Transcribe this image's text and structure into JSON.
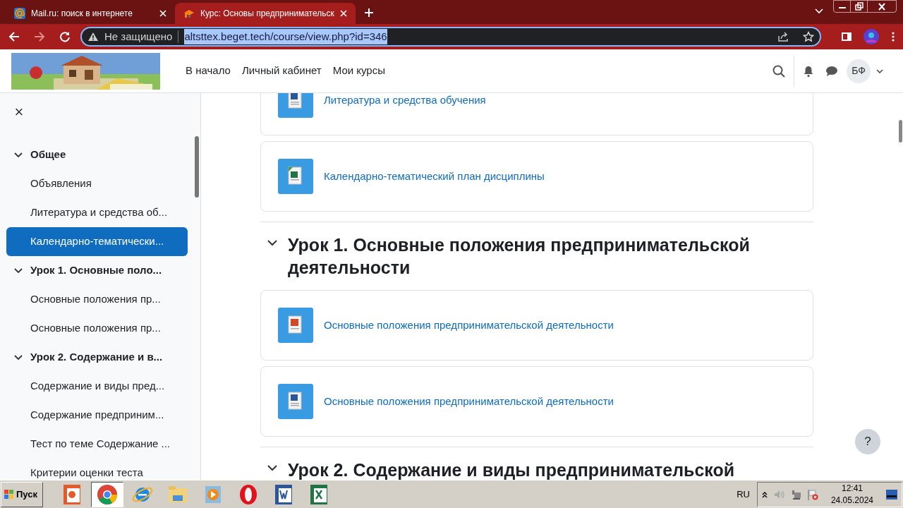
{
  "browser": {
    "tabs": [
      {
        "title": "Mail.ru: поиск в интернете",
        "kind": "mail",
        "selected": false
      },
      {
        "title": "Курс: Основы предпринимательск",
        "kind": "moodle",
        "selected": true
      }
    ],
    "security": "Не защищено",
    "url": "altsttex.beget.tech/course/view.php?id=346"
  },
  "header": {
    "nav": [
      "В начало",
      "Личный кабинет",
      "Мои курсы"
    ],
    "avatar": "БФ"
  },
  "sidebar": {
    "close": "×",
    "items": [
      {
        "kind": "section",
        "label": "Общее",
        "expanded": true,
        "selected": false
      },
      {
        "kind": "item",
        "label": "Объявления",
        "selected": false
      },
      {
        "kind": "item",
        "label": "Литература и средства об...",
        "selected": false
      },
      {
        "kind": "item",
        "label": "Календарно-тематически...",
        "selected": true
      },
      {
        "kind": "section",
        "label": "Урок 1. Основные поло...",
        "expanded": true,
        "selected": false
      },
      {
        "kind": "item",
        "label": "Основные положения пр...",
        "selected": false
      },
      {
        "kind": "item",
        "label": "Основные положения пр...",
        "selected": false
      },
      {
        "kind": "section",
        "label": "Урок 2. Содержание и в...",
        "expanded": true,
        "selected": false
      },
      {
        "kind": "item",
        "label": "Содержание и виды пред...",
        "selected": false
      },
      {
        "kind": "item",
        "label": "Содержание предприним...",
        "selected": false
      },
      {
        "kind": "item",
        "label": "Тест по теме Содержание ...",
        "selected": false
      },
      {
        "kind": "item",
        "label": "Критерии оценки теста",
        "selected": false
      }
    ]
  },
  "content": [
    {
      "kind": "word",
      "label": "Литература и средства обучения"
    },
    {
      "kind": "excel",
      "label": "Календарно-тематический план дисциплины"
    },
    {
      "kind": "section",
      "label": "Урок 1. Основные положения предпринимательской деятельности",
      "expanded": true
    },
    {
      "kind": "powerpoint",
      "label": "Основные положения предпринимательской деятельности"
    },
    {
      "kind": "word",
      "label": "Основные положения предпринимательской деятельности"
    },
    {
      "kind": "section",
      "label": "Урок 2. Содержание и виды предпринимательской",
      "expanded": true
    }
  ],
  "help": "?",
  "taskbar": {
    "start": "Пуск",
    "apps": [
      {
        "kind": "powerpoint",
        "selected": false
      },
      {
        "kind": "chrome",
        "selected": true
      },
      {
        "kind": "ie",
        "selected": false
      },
      {
        "kind": "folder",
        "selected": false
      },
      {
        "kind": "media",
        "selected": false
      },
      {
        "kind": "opera",
        "selected": false
      },
      {
        "kind": "word",
        "selected": false
      },
      {
        "kind": "excel",
        "selected": false
      }
    ],
    "lang": "RU",
    "time": "12:41",
    "date": "24.05.2024"
  }
}
